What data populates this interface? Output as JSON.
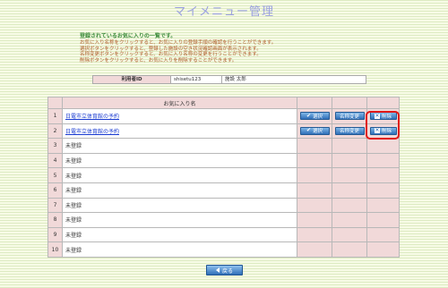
{
  "page": {
    "title": "マイメニュー管理"
  },
  "intro": {
    "heading": "登録されているお気に入りの一覧です。",
    "lines": [
      "お気に入り名称をクリックすると、お気に入りの登録手順の確認を行うことができます。",
      "選択ボタンをクリックすると、登録した施設の空き状況確認画面が表示されます。",
      "名称変更ボタンをクリックすると、お気に入り名称の変更を行うことができます。",
      "削除ボタンをクリックすると、お気に入りを削除することができます。"
    ]
  },
  "user": {
    "label": "利用者ID",
    "id": "shisetu123",
    "name": "施設 太郎"
  },
  "favorites": {
    "header": "お気に入り名",
    "select_label": "選択",
    "rename_label": "名称変更",
    "delete_label": "削除",
    "rows": [
      {
        "no": "1",
        "name": "日電市立体育館の予約",
        "registered": true
      },
      {
        "no": "2",
        "name": "日電市立体育館の予約",
        "registered": true
      },
      {
        "no": "3",
        "name": "未登録",
        "registered": false
      },
      {
        "no": "4",
        "name": "未登録",
        "registered": false
      },
      {
        "no": "5",
        "name": "未登録",
        "registered": false
      },
      {
        "no": "6",
        "name": "未登録",
        "registered": false
      },
      {
        "no": "7",
        "name": "未登録",
        "registered": false
      },
      {
        "no": "8",
        "name": "未登録",
        "registered": false
      },
      {
        "no": "9",
        "name": "未登録",
        "registered": false
      },
      {
        "no": "10",
        "name": "未登録",
        "registered": false
      }
    ]
  },
  "footer": {
    "back_label": "戻る"
  },
  "colors": {
    "highlight": "#e01818",
    "button": "#2f6fb8",
    "header_bg": "#f1d9d9"
  }
}
